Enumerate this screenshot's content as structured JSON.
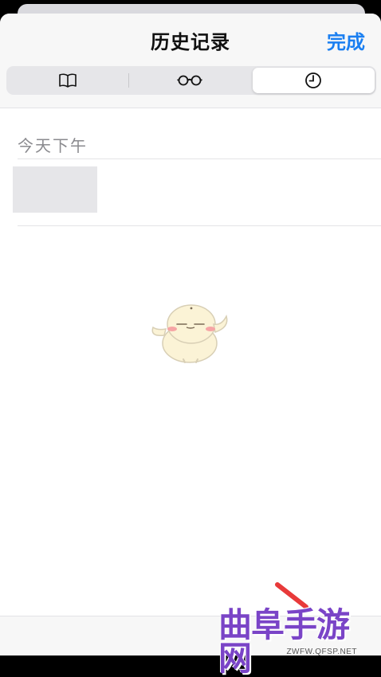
{
  "header": {
    "title": "历史记录",
    "done_label": "完成"
  },
  "tabs": [
    {
      "icon": "book-icon",
      "name": "bookmarks",
      "selected": false
    },
    {
      "icon": "glasses-icon",
      "name": "reading-list",
      "selected": false
    },
    {
      "icon": "clock-icon",
      "name": "history",
      "selected": true
    }
  ],
  "history": {
    "section_label": "今天下午",
    "items": [
      {
        "title": "",
        "thumbnail": "blank"
      }
    ]
  },
  "colors": {
    "accent": "#1a7ff1",
    "segment_bg": "#e6e6e9",
    "watermark": "#7a44c7"
  },
  "watermark": {
    "logo_text": "曲阜手游网",
    "url": "ZWFW.QFSP.NET"
  }
}
